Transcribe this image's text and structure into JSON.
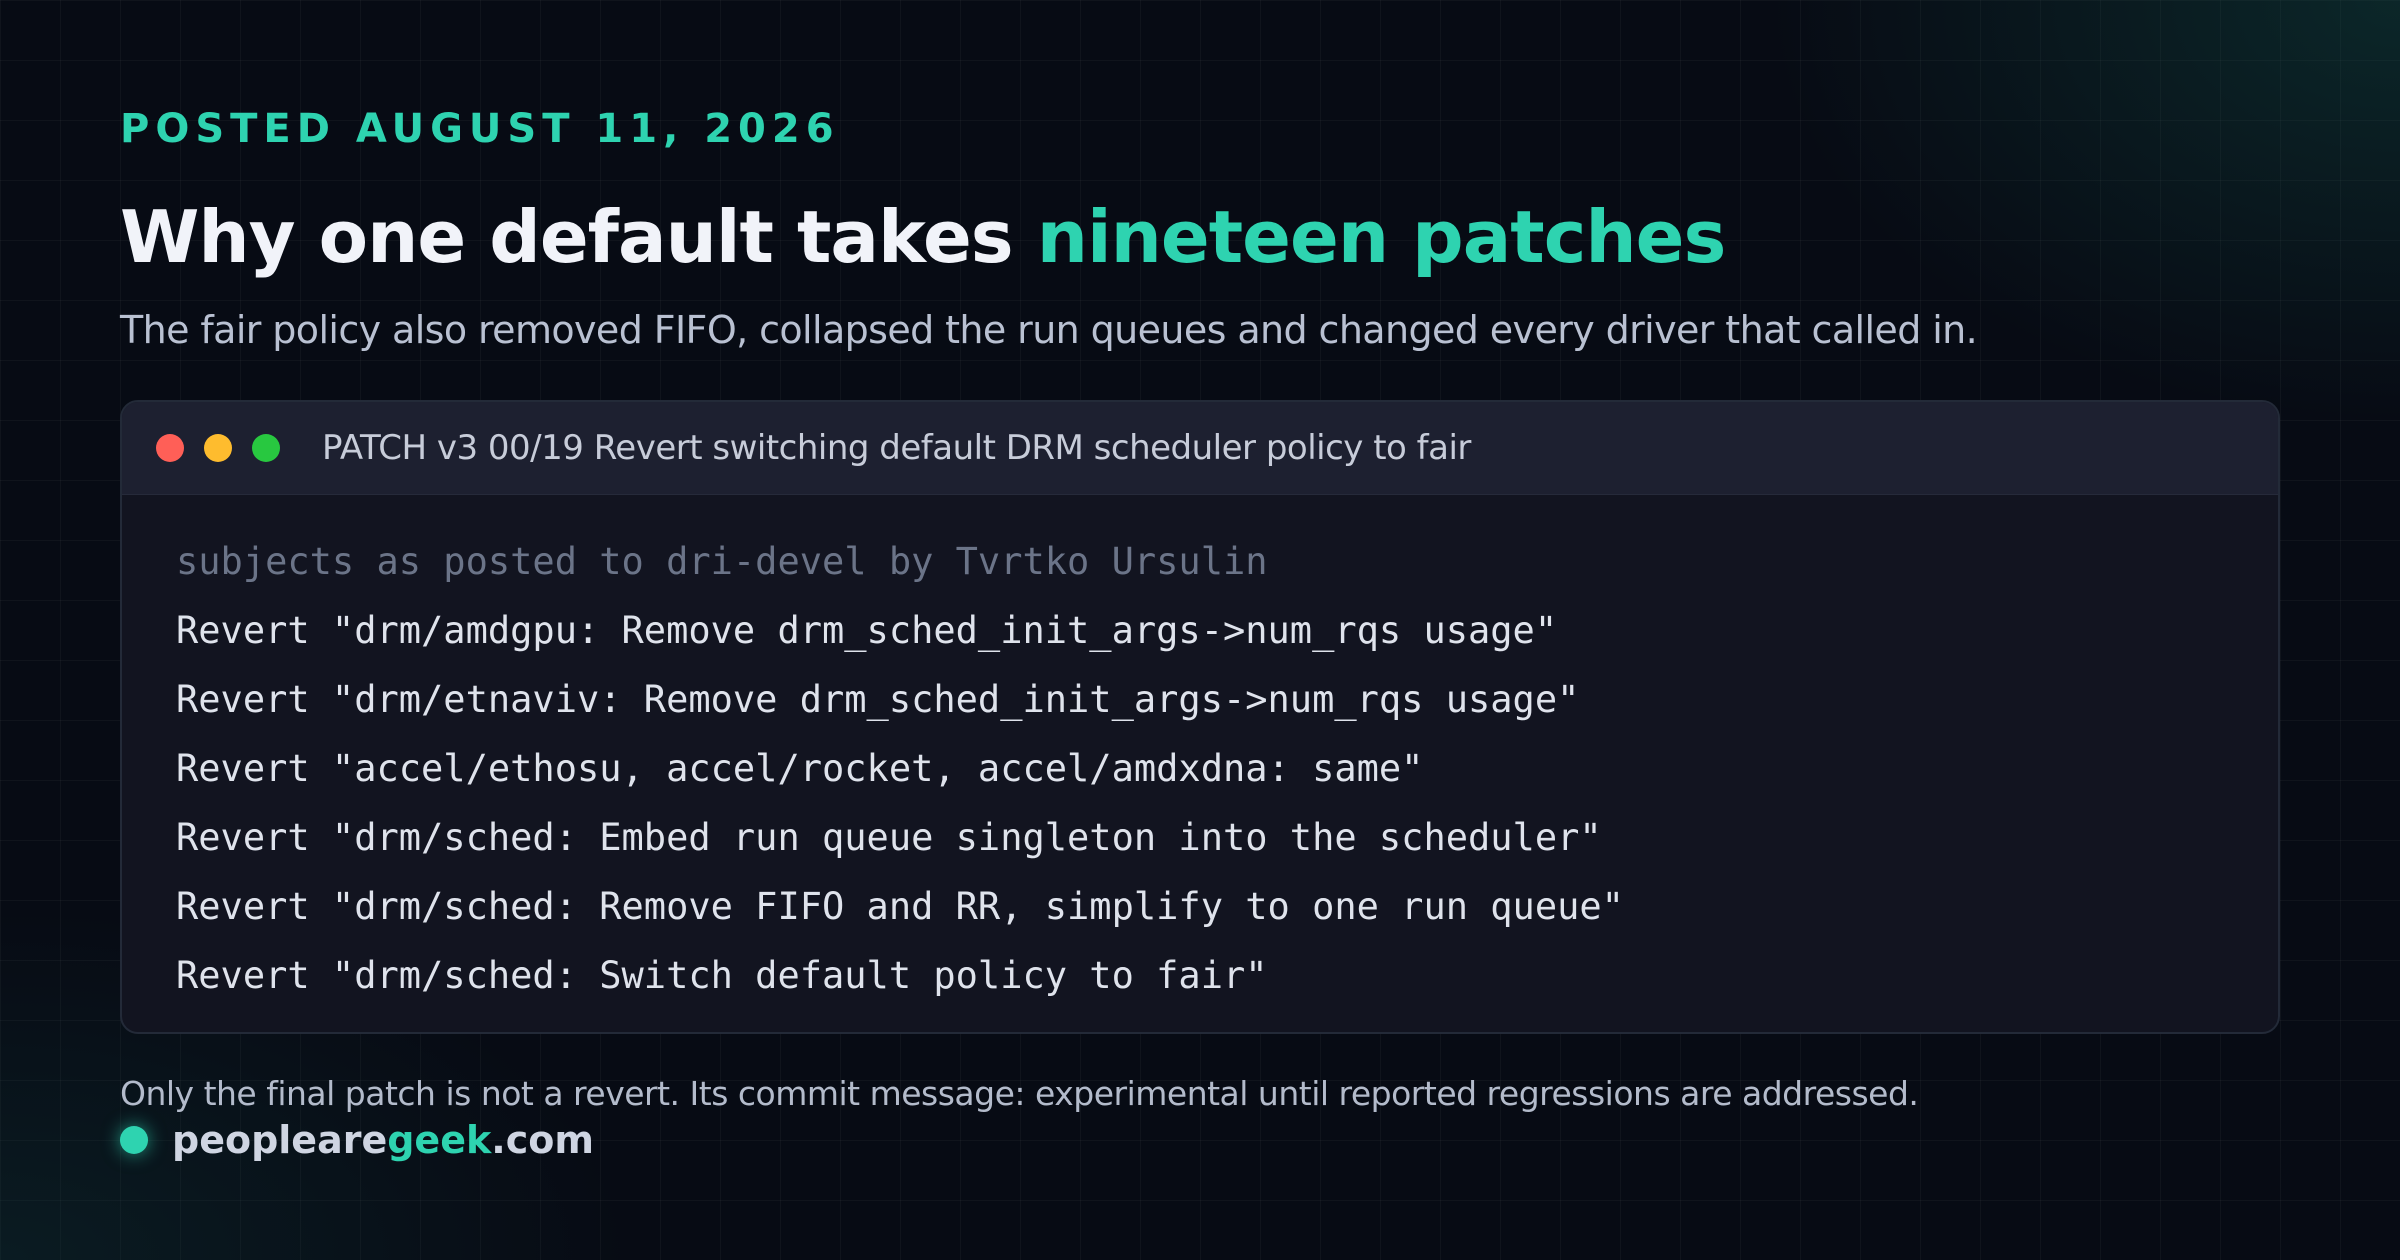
{
  "header": {
    "eyebrow": "POSTED AUGUST 11, 2026",
    "title_main": "Why one default takes ",
    "title_accent": "nineteen patches",
    "subtitle": "The fair policy also removed FIFO, collapsed the run queues and changed every driver that called in."
  },
  "terminal": {
    "title": "PATCH v3 00/19 Revert switching default DRM scheduler policy to fair",
    "comment": "subjects as posted to dri-devel by Tvrtko Ursulin",
    "lines": [
      "Revert \"drm/amdgpu: Remove drm_sched_init_args->num_rqs usage\"",
      "Revert \"drm/etnaviv: Remove drm_sched_init_args->num_rqs usage\"",
      "Revert \"accel/ethosu, accel/rocket, accel/amdxdna: same\"",
      "Revert \"drm/sched: Embed run queue singleton into the scheduler\"",
      "Revert \"drm/sched: Remove FIFO and RR, simplify to one run queue\"",
      "Revert \"drm/sched: Switch default policy to fair\""
    ],
    "window_buttons": [
      "close-dot",
      "minimize-dot",
      "maximize-dot"
    ]
  },
  "footer": {
    "note": "Only the final patch is not a revert. Its commit message: experimental until reported regressions are addressed.",
    "brand_part1": "peopleare",
    "brand_accent": "geek",
    "brand_part2": ".com"
  },
  "colors": {
    "accent": "#2ed3b0",
    "background": "#070b14",
    "terminal_bg": "#121420",
    "terminal_bar": "#1d2030",
    "dot_red": "#ff5f57",
    "dot_yellow": "#febc2e",
    "dot_green": "#28c840"
  }
}
